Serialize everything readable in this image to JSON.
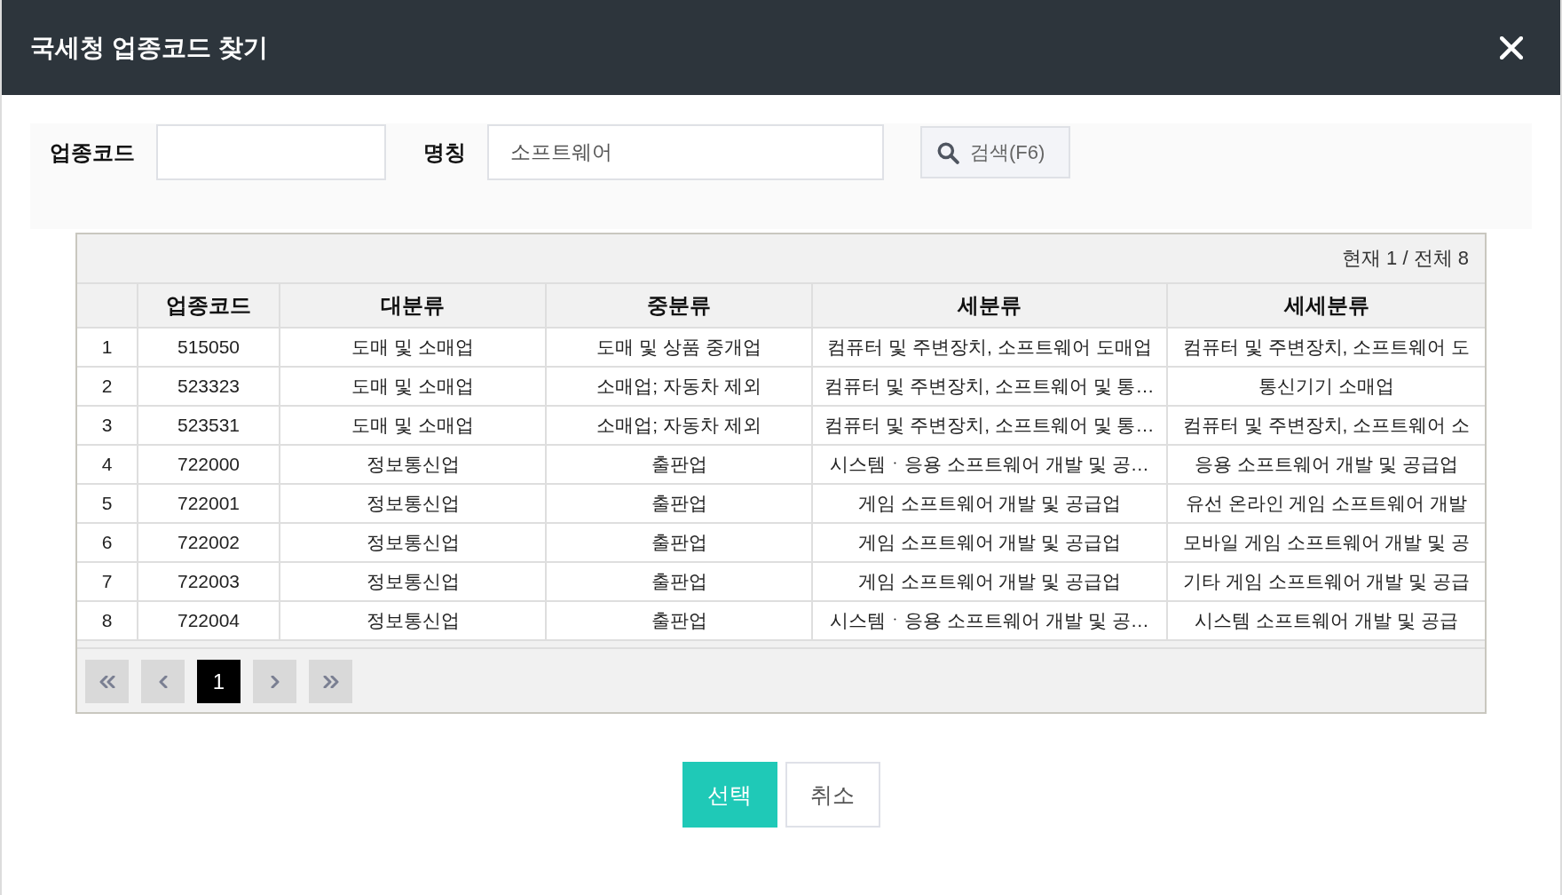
{
  "dialog": {
    "title": "국세청 업종코드 찾기"
  },
  "search": {
    "fields": [
      {
        "label": "업종코드"
      },
      {
        "label": "명칭",
        "value": "소프트웨어"
      }
    ],
    "button": {
      "label": "검색(F6)"
    }
  },
  "table": {
    "summary": "현재 1 / 전체 8",
    "columns": [
      "업종코드",
      "대분류",
      "중분류",
      "세분류",
      "세세분류"
    ],
    "rows": [
      {
        "no": "1",
        "cells": [
          "515050",
          "도매 및 소매업",
          "도매 및 상품 중개업",
          "컴퓨터 및 주변장치, 소프트웨어 도매업",
          "컴퓨터 및 주변장치, 소프트웨어 도"
        ]
      },
      {
        "no": "2",
        "cells": [
          "523323",
          "도매 및 소매업",
          "소매업; 자동차 제외",
          "컴퓨터 및 주변장치, 소프트웨어 및 통…",
          "통신기기 소매업"
        ]
      },
      {
        "no": "3",
        "cells": [
          "523531",
          "도매 및 소매업",
          "소매업; 자동차 제외",
          "컴퓨터 및 주변장치, 소프트웨어 및 통…",
          "컴퓨터 및 주변장치, 소프트웨어 소"
        ]
      },
      {
        "no": "4",
        "cells": [
          "722000",
          "정보통신업",
          "출판업",
          "시스템ㆍ응용 소프트웨어 개발 및 공…",
          "응용 소프트웨어 개발 및 공급업"
        ]
      },
      {
        "no": "5",
        "cells": [
          "722001",
          "정보통신업",
          "출판업",
          "게임 소프트웨어 개발 및 공급업",
          "유선 온라인 게임 소프트웨어 개발"
        ]
      },
      {
        "no": "6",
        "cells": [
          "722002",
          "정보통신업",
          "출판업",
          "게임 소프트웨어 개발 및 공급업",
          "모바일 게임 소프트웨어 개발 및 공"
        ]
      },
      {
        "no": "7",
        "cells": [
          "722003",
          "정보통신업",
          "출판업",
          "게임 소프트웨어 개발 및 공급업",
          "기타 게임 소프트웨어 개발 및 공급"
        ]
      },
      {
        "no": "8",
        "cells": [
          "722004",
          "정보통신업",
          "출판업",
          "시스템ㆍ응용 소프트웨어 개발 및 공…",
          "시스템 소프트웨어 개발 및 공급"
        ]
      }
    ]
  },
  "pagination": {
    "pages": [
      {
        "label": "1",
        "selected": true
      }
    ]
  },
  "buttons": [
    {
      "label": "선택",
      "kind": "confirm"
    },
    {
      "label": "취소",
      "kind": "cancel"
    }
  ]
}
